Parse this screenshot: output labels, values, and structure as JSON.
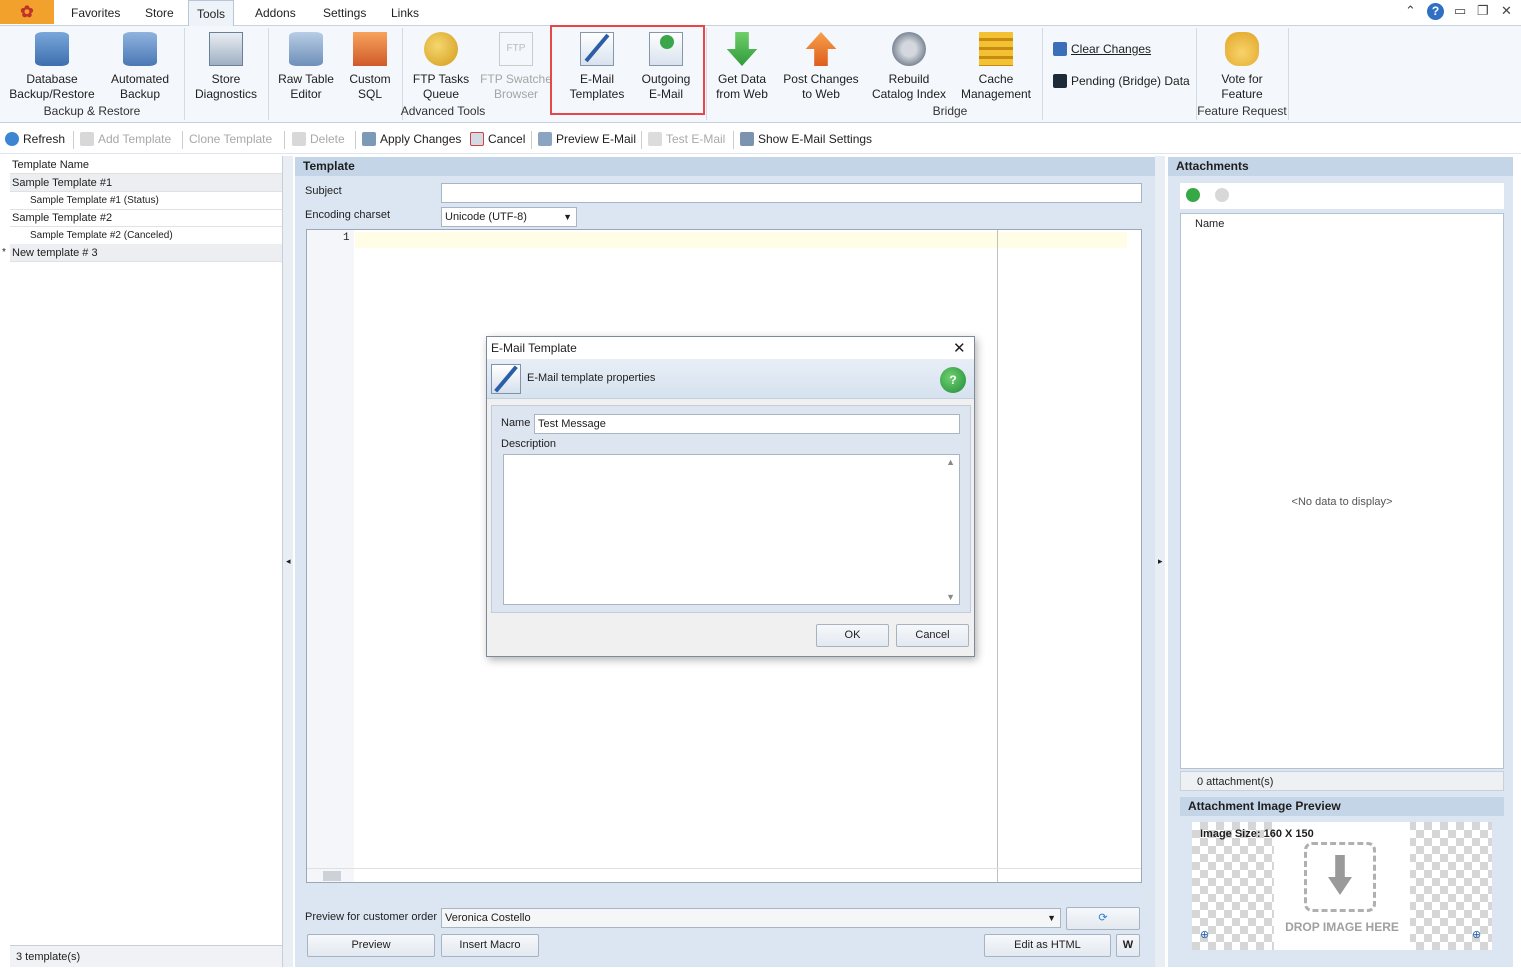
{
  "menu": {
    "tabs": [
      "Favorites",
      "Store",
      "Tools",
      "Addons",
      "Settings",
      "Links"
    ],
    "active": "Tools"
  },
  "ribbon": {
    "groups": [
      {
        "label": "Backup & Restore",
        "buttons": [
          {
            "l1": "Database",
            "l2": "Backup/Restore"
          },
          {
            "l1": "Automated",
            "l2": "Backup"
          }
        ]
      },
      {
        "label": "",
        "buttons": [
          {
            "l1": "Store",
            "l2": "Diagnostics"
          }
        ]
      },
      {
        "label": "Advanced Tools",
        "buttons": [
          {
            "l1": "Raw Table",
            "l2": "Editor"
          },
          {
            "l1": "Custom",
            "l2": "SQL"
          },
          {
            "l1": "FTP Tasks",
            "l2": "Queue"
          },
          {
            "l1": "FTP Swatche",
            "l2": "Browser"
          },
          {
            "l1": "E-Mail",
            "l2": "Templates"
          },
          {
            "l1": "Outgoing",
            "l2": "E-Mail"
          }
        ]
      },
      {
        "label": "Bridge",
        "buttons": [
          {
            "l1": "Get Data",
            "l2": "from Web"
          },
          {
            "l1": "Post Changes",
            "l2": "to Web"
          },
          {
            "l1": "Rebuild",
            "l2": "Catalog Index"
          },
          {
            "l1": "Cache",
            "l2": "Management"
          }
        ]
      },
      {
        "label": "Feature Request",
        "buttons": [
          {
            "l1": "Vote for",
            "l2": "Feature"
          }
        ]
      }
    ],
    "small": {
      "clear": "Clear Changes",
      "pending": "Pending (Bridge) Data"
    }
  },
  "toolbar": {
    "refresh": "Refresh",
    "add": "Add Template",
    "clone": "Clone Template",
    "delete": "Delete",
    "apply": "Apply Changes",
    "cancel": "Cancel",
    "preview": "Preview E-Mail",
    "test": "Test E-Mail",
    "settings": "Show E-Mail Settings"
  },
  "list": {
    "header": "Template Name",
    "rows": [
      {
        "text": "Sample Template #1",
        "indent": false
      },
      {
        "text": "Sample Template #1 (Status)",
        "indent": true
      },
      {
        "text": "Sample Template #2",
        "indent": false
      },
      {
        "text": "Sample Template #2 (Canceled)",
        "indent": true
      },
      {
        "text": "New template # 3",
        "indent": false
      }
    ],
    "footer": "3 template(s)"
  },
  "template": {
    "title": "Template",
    "subject_label": "Subject",
    "subject_value": "",
    "encoding_label": "Encoding charset",
    "encoding_value": "Unicode (UTF-8)",
    "line_number": "1",
    "preview_label": "Preview for customer order",
    "preview_value": "Veronica Costello",
    "preview_btn": "Preview",
    "macro_btn": "Insert Macro",
    "html_btn": "Edit as HTML"
  },
  "attachments": {
    "title": "Attachments",
    "col_name": "Name",
    "empty": "<No data to display>",
    "count": "0 attachment(s)",
    "preview_title": "Attachment Image Preview",
    "image_size": "Image Size: 160 X 150",
    "drop": "DROP IMAGE HERE"
  },
  "dialog": {
    "title": "E-Mail Template",
    "subtitle": "E-Mail template properties",
    "name_label": "Name",
    "name_value": "Test Message",
    "desc_label": "Description",
    "ok": "OK",
    "cancel": "Cancel"
  }
}
